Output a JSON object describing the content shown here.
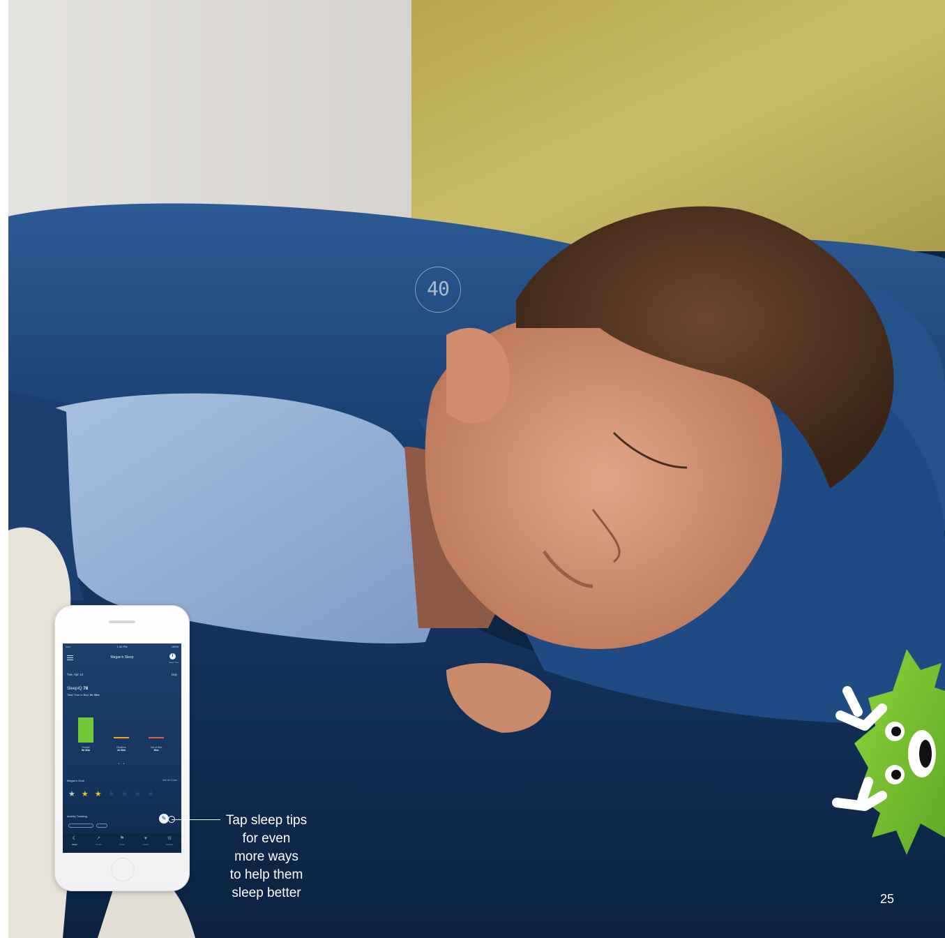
{
  "bed_display": {
    "number": "40"
  },
  "callout": {
    "lines": [
      "Tap sleep tips",
      "for even",
      "more ways",
      "to help them",
      "sleep better"
    ]
  },
  "page_number": "25",
  "app_screen": {
    "status_carrier": "•••••  ",
    "status_time": "1:32 PM",
    "status_battery": "100%",
    "title": "Megan's Sleep",
    "info_label": "Sleep Tips",
    "date": "Tue, Apr 14",
    "view": "Day",
    "sleepiq_label": "SleepIQ",
    "sleepiq_score": "78",
    "total_time_label": "Total Time in Bed:",
    "total_time_value": "9h 00m",
    "breakdown": [
      {
        "name": "Restful",
        "value": "8h 30m"
      },
      {
        "name": "Restless",
        "value": "1h 00m"
      },
      {
        "name": "Out of Bed",
        "value": "30m"
      }
    ],
    "goal_title": "Megan's Goal",
    "see_all": "See All Goals",
    "activity_title": "Activity Tracking",
    "nav": [
      "Sleep",
      "Trends",
      "Goals",
      "Health",
      "Settings"
    ]
  },
  "colors": {
    "restful": "#72c93a",
    "restless": "#f2a12e",
    "out_of_bed": "#e05b52",
    "screen_bg": "#173660"
  }
}
